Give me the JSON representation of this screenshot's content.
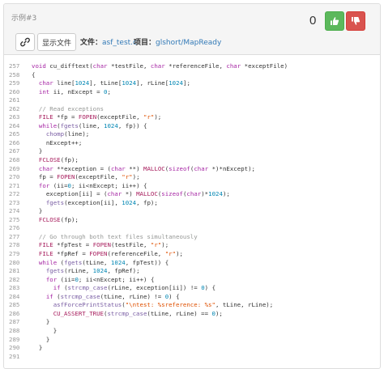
{
  "header": {
    "example_label": "示例#3",
    "score": "0",
    "show_files_label": "显示文件",
    "file_label": "文件：",
    "file_name": "asf_test.c",
    "project_label": "项目：",
    "project_name": "glshort/MapReady",
    "colors": {
      "upvote": "#5cb85c",
      "downvote": "#d9534f",
      "link": "#337ab7"
    }
  },
  "icons": {
    "link": "link-icon",
    "upvote": "thumbs-up-icon",
    "downvote": "thumbs-down-icon"
  },
  "code_lines": [
    {
      "n": "257",
      "t": "void cu_difftext(char *testFile, char *referenceFile, char *exceptFile)"
    },
    {
      "n": "258",
      "t": "{"
    },
    {
      "n": "259",
      "t": "  char line[1024], tLine[1024], rLine[1024];"
    },
    {
      "n": "260",
      "t": "  int ii, nExcept = 0;"
    },
    {
      "n": "261",
      "t": ""
    },
    {
      "n": "262",
      "t": "  // Read exceptions"
    },
    {
      "n": "263",
      "t": "  FILE *fp = FOPEN(exceptFile, \"r\");"
    },
    {
      "n": "264",
      "t": "  while(fgets(line, 1024, fp)) {"
    },
    {
      "n": "265",
      "t": "    chomp(line);"
    },
    {
      "n": "266",
      "t": "    nExcept++;"
    },
    {
      "n": "267",
      "t": "  }"
    },
    {
      "n": "268",
      "t": "  FCLOSE(fp);"
    },
    {
      "n": "269",
      "t": "  char **exception = (char **) MALLOC(sizeof(char *)*nExcept);"
    },
    {
      "n": "270",
      "t": "  fp = FOPEN(exceptFile, \"r\");"
    },
    {
      "n": "271",
      "t": "  for (ii=0; ii<nExcept; ii++) {"
    },
    {
      "n": "272",
      "t": "    exception[ii] = (char *) MALLOC(sizeof(char)*1024);"
    },
    {
      "n": "273",
      "t": "    fgets(exception[ii], 1024, fp);"
    },
    {
      "n": "274",
      "t": "  }"
    },
    {
      "n": "275",
      "t": "  FCLOSE(fp);"
    },
    {
      "n": "276",
      "t": ""
    },
    {
      "n": "277",
      "t": "  // Go through both text files simultaneously"
    },
    {
      "n": "278",
      "t": "  FILE *fpTest = FOPEN(testFile, \"r\");"
    },
    {
      "n": "279",
      "t": "  FILE *fpRef = FOPEN(referenceFile, \"r\");"
    },
    {
      "n": "280",
      "t": "  while (fgets(tLine, 1024, fpTest)) {"
    },
    {
      "n": "281",
      "t": "    fgets(rLine, 1024, fpRef);"
    },
    {
      "n": "282",
      "t": "    for (ii=0; ii<nExcept; ii++) {"
    },
    {
      "n": "283",
      "t": "      if (strcmp_case(rLine, exception[ii]) != 0) {"
    },
    {
      "n": "284",
      "t": "    if (strcmp_case(tLine, rLine) != 0) {"
    },
    {
      "n": "285",
      "t": "      asfForcePrintStatus(\"\\ntest: %sreference: %s\", tLine, rLine);"
    },
    {
      "n": "286",
      "t": "      CU_ASSERT_TRUE(strcmp_case(tLine, rLine) == 0);"
    },
    {
      "n": "287",
      "t": "    }"
    },
    {
      "n": "288",
      "t": "      }"
    },
    {
      "n": "289",
      "t": "    }"
    },
    {
      "n": "290",
      "t": "  }"
    },
    {
      "n": "291",
      "t": ""
    }
  ]
}
